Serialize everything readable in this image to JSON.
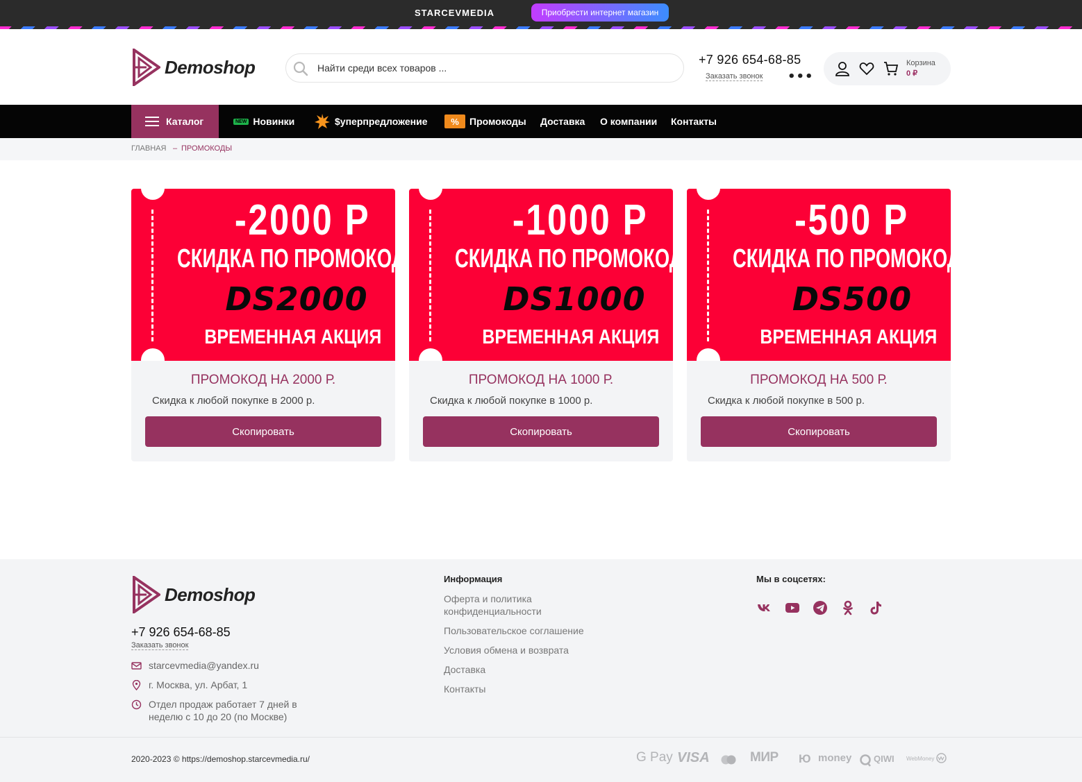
{
  "topbar": {
    "brand": "STARCEVMEDIA",
    "buy_button": "Приобрести интернет магазин"
  },
  "header": {
    "logo_text": "Demoshop",
    "search_placeholder": "Найти среди всех товаров ...",
    "phone": "+7 926 654-68-85",
    "callback": "Заказать звонок",
    "more": "•••",
    "cart_label": "Корзина",
    "cart_sum": "0 ₽"
  },
  "nav": {
    "catalog": "Каталог",
    "items": [
      {
        "label": "Новинки",
        "badge": "NEW"
      },
      {
        "label": "$уперпредложение"
      },
      {
        "label": "Промокоды",
        "badge": "%"
      },
      {
        "label": "Доставка"
      },
      {
        "label": "О компании"
      },
      {
        "label": "Контакты"
      }
    ]
  },
  "breadcrumb": {
    "home": "Главная",
    "separator": "–",
    "current": "Промокоды"
  },
  "promos": [
    {
      "amount": "-2000 Р",
      "subtitle": "СКИДКА ПО ПРОМОКОДУ",
      "code": "DS2000",
      "action": "ВРЕМЕННАЯ АКЦИЯ",
      "title": "ПРОМОКОД НА 2000 Р.",
      "description": "Скидка к любой покупке в 2000 р.",
      "button": "Скопировать"
    },
    {
      "amount": "-1000 Р",
      "subtitle": "СКИДКА ПО ПРОМОКОДУ",
      "code": "DS1000",
      "action": "ВРЕМЕННАЯ АКЦИЯ",
      "title": "ПРОМОКОД НА 1000 Р.",
      "description": "Скидка к любой покупке в 1000 р.",
      "button": "Скопировать"
    },
    {
      "amount": "-500 Р",
      "subtitle": "СКИДКА ПО ПРОМОКОДУ",
      "code": "DS500",
      "action": "ВРЕМЕННАЯ АКЦИЯ",
      "title": "ПРОМОКОД НА 500 Р.",
      "description": "Скидка к любой покупке в 500 р.",
      "button": "Скопировать"
    }
  ],
  "footer": {
    "logo_text": "Demoshop",
    "phone": "+7 926 654-68-85",
    "callback": "Заказать звонок",
    "email": "starcevmedia@yandex.ru",
    "address": "г. Москва, ул. Арбат, 1",
    "hours_line1": "Отдел продаж работает 7 дней в",
    "hours_line2": "неделю с 10 до 20 (по Москве)",
    "info_title": "Информация",
    "info_links": [
      "Оферта и политика конфиденциальности",
      "Пользовательское соглашение",
      "Условия обмена и возврата",
      "Доставка",
      "Контакты"
    ],
    "social_title": "Мы в соцсетях:",
    "social_icons": [
      "vk-icon",
      "youtube-icon",
      "telegram-icon",
      "odnoklassniki-icon",
      "tiktok-icon"
    ],
    "copyright": "2020-2023 © https://demoshop.starcevmedia.ru/",
    "payments": [
      "G Pay",
      "VISA",
      "mastercard",
      "МИР",
      "ЮMoney",
      "QIWI",
      "WebMoney"
    ],
    "payment_texts": {
      "gpay": "G Pay",
      "visa": "VISA",
      "mir": "МИР",
      "yoomoney": "money",
      "yoo_mark": "Ю",
      "qiwi": "QIWI",
      "webmoney": "WebMoney"
    }
  },
  "colors": {
    "accent": "#96325f",
    "promo_red": "#fc0036",
    "topbar": "#2b2b2b",
    "nav": "#050505",
    "footer_bg": "#f3f4f6"
  }
}
